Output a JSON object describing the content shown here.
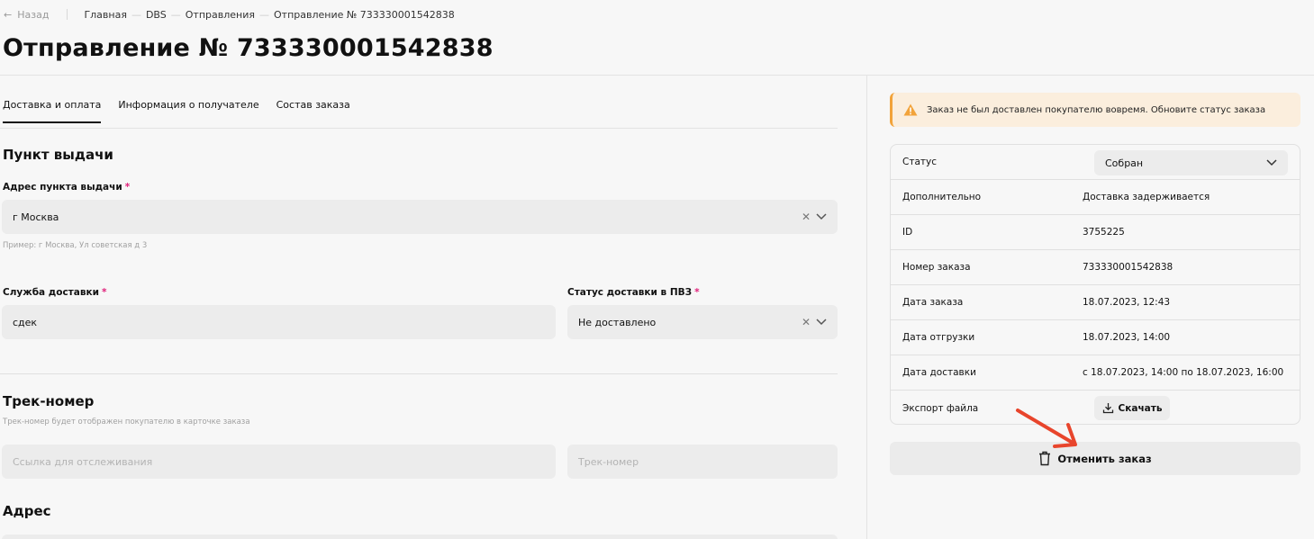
{
  "nav": {
    "back_label": "Назад",
    "breadcrumbs": [
      "Главная",
      "DBS",
      "Отправления",
      "Отправление № 733330001542838"
    ]
  },
  "page_title": "Отправление № 733330001542838",
  "tabs": [
    {
      "label": "Доставка и оплата",
      "active": true
    },
    {
      "label": "Информация о получателе",
      "active": false
    },
    {
      "label": "Состав заказа",
      "active": false
    }
  ],
  "pickup": {
    "section_title": "Пункт выдачи",
    "address_label": "Адрес пункта выдачи",
    "address_value": "г Москва",
    "address_hint": "Пример: г Москва, Ул советская д 3",
    "service_label": "Служба доставки",
    "service_value": "сдек",
    "status_label": "Статус доставки в ПВЗ",
    "status_value": "Не доставлено",
    "required_mark": "*"
  },
  "track": {
    "section_title": "Трек-номер",
    "hint": "Трек-номер будет отображен покупателю в карточке заказа",
    "link_placeholder": "Ссылка для отслеживания",
    "number_placeholder": "Трек-номер"
  },
  "address": {
    "section_title": "Адрес"
  },
  "alert": {
    "text": "Заказ не был доставлен покупателю вовремя. Обновите статус заказа",
    "icon": "warning-icon",
    "color": "#f2a33a"
  },
  "info": {
    "status_label": "Статус",
    "status_value": "Собран",
    "rows": [
      {
        "label": "Дополнительно",
        "value": "Доставка задерживается"
      },
      {
        "label": "ID",
        "value": "3755225"
      },
      {
        "label": "Номер заказа",
        "value": "733330001542838"
      },
      {
        "label": "Дата заказа",
        "value": "18.07.2023, 12:43"
      },
      {
        "label": "Дата отгрузки",
        "value": "18.07.2023, 14:00"
      },
      {
        "label": "Дата доставки",
        "value": "с 18.07.2023, 14:00 по 18.07.2023, 16:00"
      }
    ],
    "export_label": "Экспорт файла",
    "download_label": "Скачать"
  },
  "cancel_label": "Отменить заказ",
  "accent_color": "#e0207a",
  "annotation_color": "#e8452c"
}
